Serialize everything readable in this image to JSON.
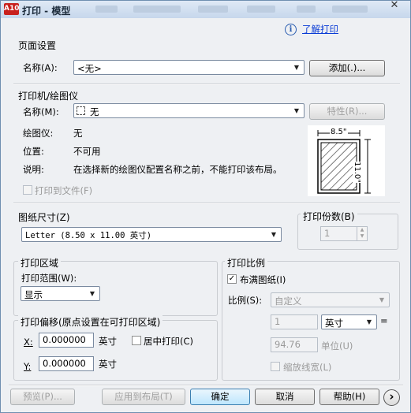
{
  "window": {
    "title": "打印 - 模型",
    "app_icon_text": "A10",
    "close_glyph": "✕"
  },
  "help": {
    "info_icon": "i",
    "learn_link": "了解打印"
  },
  "page_setup": {
    "section": "页面设置",
    "name_label": "名称(A):",
    "name_value": "<无>",
    "add_button": "添加(.)..."
  },
  "printer": {
    "section": "打印机/绘图仪",
    "name_label": "名称(M):",
    "name_value": "无",
    "properties_button": "特性(R)...",
    "plotter_label": "绘图仪:",
    "plotter_value": "无",
    "location_label": "位置:",
    "location_value": "不可用",
    "description_label": "说明:",
    "description_value": "在选择新的绘图仪配置名称之前，不能打印该布局。",
    "print_to_file": "打印到文件(F)",
    "preview_width": "8.5\"",
    "preview_height": "11.0\""
  },
  "paper_size": {
    "section": "图纸尺寸(Z)",
    "value": "Letter (8.50 x 11.00 英寸)"
  },
  "copies": {
    "section": "打印份数(B)",
    "value": "1"
  },
  "plot_area": {
    "section": "打印区域",
    "range_label": "打印范围(W):",
    "range_value": "显示"
  },
  "plot_offset": {
    "section": "打印偏移(原点设置在可打印区域)",
    "x_label": "X:",
    "x_value": "0.000000",
    "x_unit": "英寸",
    "center_label": "居中打印(C)",
    "y_label": "Y:",
    "y_value": "0.000000",
    "y_unit": "英寸"
  },
  "plot_scale": {
    "section": "打印比例",
    "fit_label": "布满图纸(I)",
    "fit_checked": true,
    "scale_label": "比例(S):",
    "scale_value": "自定义",
    "value1": "1",
    "unit_value": "英寸",
    "equals": "=",
    "value2": "94.76",
    "unit2": "单位(U)",
    "lineweights": "缩放线宽(L)"
  },
  "footer": {
    "preview": "预览(P)...",
    "apply_layout": "应用到布局(T)",
    "ok": "确定",
    "cancel": "取消",
    "help": "帮助(H)",
    "expand_glyph": "›"
  }
}
